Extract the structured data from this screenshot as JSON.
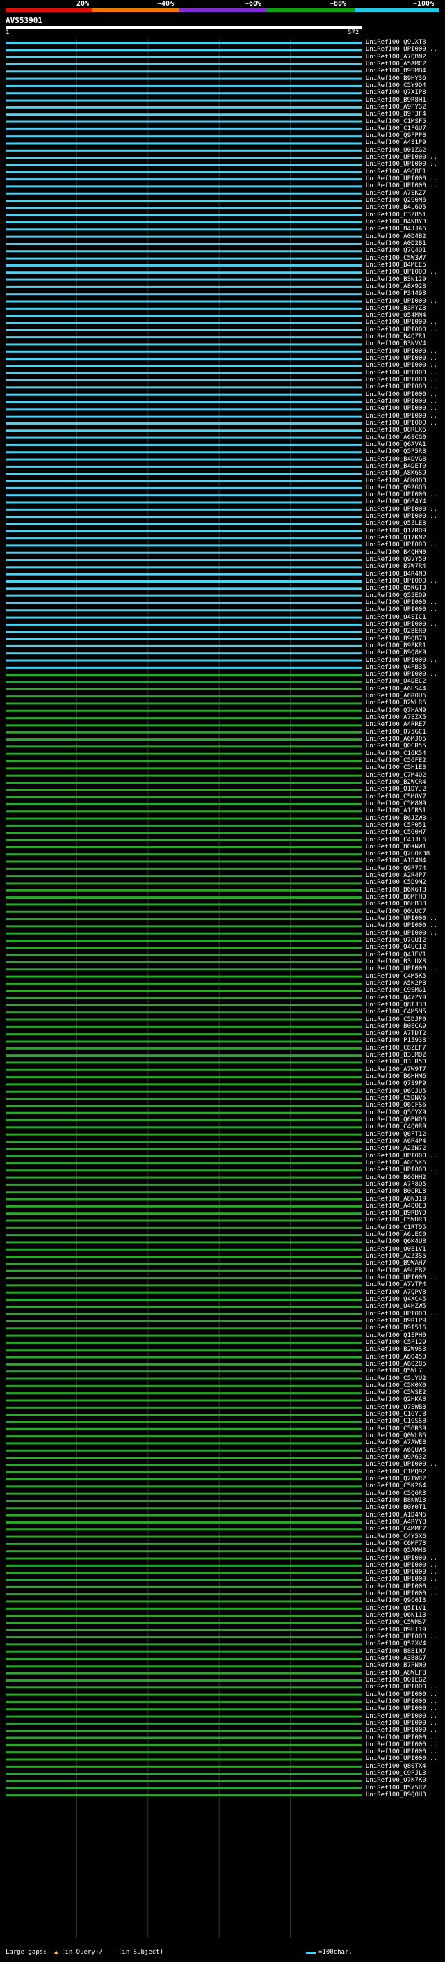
{
  "scale": {
    "labels": [
      "20%",
      "~40%",
      "~60%",
      "~80%",
      "~100%"
    ],
    "colors": [
      "#e01010",
      "#f07800",
      "#8030d0",
      "#10a010",
      "#20c8e0"
    ]
  },
  "query": {
    "title": "AVS53901",
    "start": "1",
    "end": "572"
  },
  "legend": {
    "gaps_label": "Large gaps:",
    "gap_query_text": "(in Query)/",
    "gap_subject_text": "(in Subject)",
    "scale_text": "=100char."
  },
  "colors": {
    "high_identity": "#4fd0f0",
    "medium_identity": "#2aa82a",
    "gap": "#000000",
    "label": "#ffffff"
  },
  "hits": [
    "UniRef100_Q9LXT8",
    "UniRef100_UPI000...",
    "UniRef100_A7QBN2",
    "UniRef100_A5AMC2",
    "UniRef100_B9SMB4",
    "UniRef100_B9HY36",
    "UniRef100_C5Y9D4",
    "UniRef100_Q7XIP8",
    "UniRef100_B9R8H1",
    "UniRef100_A9PYS2",
    "UniRef100_B9F3F4",
    "UniRef100_C1MSF5",
    "UniRef100_C1FGU7",
    "UniRef100_Q9FPP8",
    "UniRef100_A4S1P9",
    "UniRef100_Q01ZG2",
    "UniRef100_UPI000...",
    "UniRef100_UPI000...",
    "UniRef100_A9QBE1",
    "UniRef100_UPI000...",
    "UniRef100_UPI000...",
    "UniRef100_A7SKZ7",
    "UniRef100_Q2G0N6",
    "UniRef100_B4L6Q5",
    "UniRef100_C3Z851",
    "UniRef100_B4NBY3",
    "UniRef100_B4JJA6",
    "UniRef100_A0D4B2",
    "UniRef100_A0D2B1",
    "UniRef100_Q7Q4Q1",
    "UniRef100_C5W3W7",
    "UniRef100_B4MEE5",
    "UniRef100_UPI000...",
    "UniRef100_B3N129",
    "UniRef100_A8X928",
    "UniRef100_P34498",
    "UniRef100_UPI000...",
    "UniRef100_B3RYZ3",
    "UniRef100_Q54MN4",
    "UniRef100_UPI000...",
    "UniRef100_UPI000...",
    "UniRef100_B4QZR1",
    "UniRef100_B3NVV4",
    "UniRef100_UPI000...",
    "UniRef100_UPI000...",
    "UniRef100_UPI000...",
    "UniRef100_UPI000...",
    "UniRef100_UPI000...",
    "UniRef100_UPI000...",
    "UniRef100_UPI000...",
    "UniRef100_UPI000...",
    "UniRef100_UPI000...",
    "UniRef100_UPI000...",
    "UniRef100_UPI000...",
    "UniRef100_Q8RLX6",
    "UniRef100_A6SCG0",
    "UniRef100_Q6AVA1",
    "UniRef100_Q5P5R8",
    "UniRef100_B4DVG8",
    "UniRef100_B4DET0",
    "UniRef100_A8K6S9",
    "UniRef100_A8K0Q3",
    "UniRef100_Q92GQ5",
    "UniRef100_UPI000...",
    "UniRef100_Q6P4Y4",
    "UniRef100_UPI000...",
    "UniRef100_UPI000...",
    "UniRef100_Q5ZLE8",
    "UniRef100_Q17RO9",
    "UniRef100_Q17KN2",
    "UniRef100_UPI000...",
    "UniRef100_B4QHM0",
    "UniRef100_Q9VY50",
    "UniRef100_B7W7R4",
    "UniRef100_B4R4N0",
    "UniRef100_UPI000...",
    "UniRef100_Q5KGT3",
    "UniRef100_Q55EQ9",
    "UniRef100_UPI000...",
    "UniRef100_UPI000...",
    "UniRef100_Q4SIC1",
    "UniRef100_UPI000...",
    "UniRef100_Q2BER0",
    "UniRef100_B9QB70",
    "UniRef100_B9PKR1",
    "UniRef100_B9Q8K9",
    "UniRef100_UPI000...",
    "UniRef100_Q4PB35",
    "UniRef100_UPI000...",
    "UniRef100_Q4DEC2",
    "UniRef100_A6US44",
    "UniRef100_A6R0U6",
    "UniRef100_B2WLR6",
    "UniRef100_Q7HAM9",
    "UniRef100_A7EZX5",
    "UniRef100_A4RRE7",
    "UniRef100_Q75GC1",
    "UniRef100_A6MJ05",
    "UniRef100_Q0CR55",
    "UniRef100_C1GK54",
    "UniRef100_C5GFE2",
    "UniRef100_C5H1E3",
    "UniRef100_C7M4Q2",
    "UniRef100_B2WCR4",
    "UniRef100_Q1DYJ2",
    "UniRef100_C5M8Y7",
    "UniRef100_C5M8N9",
    "UniRef100_A1CRS1",
    "UniRef100_B6JZW3",
    "UniRef100_C5P051",
    "UniRef100_C5G0H7",
    "UniRef100_C4JJL6",
    "UniRef100_B0XNW1",
    "UniRef100_Q2U0K38",
    "UniRef100_A1D4N4",
    "UniRef100_Q9P774",
    "UniRef100_A2R4P7",
    "UniRef100_C5D9M2",
    "UniRef100_B6K6T8",
    "UniRef100_B8MFH0",
    "UniRef100_B6HB38",
    "UniRef100_Q0UUC7",
    "UniRef100_UPI000...",
    "UniRef100_UPI000...",
    "UniRef100_UPI000...",
    "UniRef100_Q7QUI2",
    "UniRef100_Q4UCI2",
    "UniRef100_Q4JEV1",
    "UniRef100_B3LUX8",
    "UniRef100_UPI000...",
    "UniRef100_C4M5K5",
    "UniRef100_A5K2P8",
    "UniRef100_C9SMG1",
    "UniRef100_Q4YZY9",
    "UniRef100_Q8TJ38",
    "UniRef100_C4M5M5",
    "UniRef100_C5DJP0",
    "UniRef100_B0ECA9",
    "UniRef100_A7TDT2",
    "UniRef100_P15938",
    "UniRef100_C8ZEF7",
    "UniRef100_B3LMQ2",
    "UniRef100_B3LR50",
    "UniRef100_A7W9T7",
    "UniRef100_B6HHM6",
    "UniRef100_Q7S9P9",
    "UniRef100_Q6CJU5",
    "UniRef100_C5DNV5",
    "UniRef100_Q6CFS6",
    "UniRef100_Q5CYX9",
    "UniRef100_Q6BNQ6",
    "UniRef100_C4Q0R9",
    "UniRef100_Q6FT12",
    "UniRef100_A6R4P4",
    "UniRef100_A2ZN72",
    "UniRef100_UPI000...",
    "UniRef100_A0C5K6",
    "UniRef100_UPI000...",
    "UniRef100_B6GHH2",
    "UniRef100_A7F8Q5",
    "UniRef100_B0CRL8",
    "UniRef100_A8N319",
    "UniRef100_A4QQE3",
    "UniRef100_B9RBY0",
    "UniRef100_C5WUR3",
    "UniRef100_C1RTQ5",
    "UniRef100_A6LEC0",
    "UniRef100_Q6K4U8",
    "UniRef100_Q0E1V1",
    "UniRef100_A2Z3S5",
    "UniRef100_B9WAH7",
    "UniRef100_A9UEB2",
    "UniRef100_UPI000...",
    "UniRef100_A7VTP4",
    "UniRef100_A7QPV8",
    "UniRef100_Q4XC45",
    "UniRef100_Q4HZW5",
    "UniRef100_UPI000...",
    "UniRef100_B9R1P9",
    "UniRef100_B9I516",
    "UniRef100_Q1EPH0",
    "UniRef100_C5P129",
    "UniRef100_B2W9S3",
    "UniRef100_A8Q450",
    "UniRef100_A6Q285",
    "UniRef100_Q5WL7",
    "UniRef100_C5LYU2",
    "UniRef100_C5K0X0",
    "UniRef100_C5WSE2",
    "UniRef100_Q2HKA8",
    "UniRef100_Q7SWB3",
    "UniRef100_C1GYJ8",
    "UniRef100_C1GSS8",
    "UniRef100_C5GR39",
    "UniRef100_Q0WLB6",
    "UniRef100_A7AWE8",
    "UniRef100_A6QUW5",
    "UniRef100_Q9A632",
    "UniRef100_UPI000...",
    "UniRef100_C1MQ92",
    "UniRef100_Q2TWR2",
    "UniRef100_C5K264",
    "UniRef100_C5Q6R3",
    "UniRef100_B8NW13",
    "UniRef100_B0Y0T1",
    "UniRef100_A1D4M6",
    "UniRef100_A4RYY8",
    "UniRef100_C4MME7",
    "UniRef100_C4Y5X6",
    "UniRef100_C6MF73",
    "UniRef100_Q5AMH3",
    "UniRef100_UPI000...",
    "UniRef100_UPI000...",
    "UniRef100_UPI000...",
    "UniRef100_UPI000...",
    "UniRef100_UPI000...",
    "UniRef100_UPI000...",
    "UniRef100_Q9C0I3",
    "UniRef100_Q5I1V1",
    "UniRef100_Q6N113",
    "UniRef100_C5WMS7",
    "UniRef100_B9HI19",
    "UniRef100_UPI000...",
    "UniRef100_Q52XV4",
    "UniRef100_B8B1N7",
    "UniRef100_A3B8G7",
    "UniRef100_B7PNN0",
    "UniRef100_A8WLF8",
    "UniRef100_Q01EG2",
    "UniRef100_UPI000...",
    "UniRef100_UPI000...",
    "UniRef100_UPI000...",
    "UniRef100_UPI000...",
    "UniRef100_UPI000...",
    "UniRef100_UPI000...",
    "UniRef100_UPI000...",
    "UniRef100_UPI000...",
    "UniRef100_UPI000...",
    "UniRef100_UPI000...",
    "UniRef100_UPI000...",
    "UniRef100_Q80TX4",
    "UniRef100_C9PJL3",
    "UniRef100_Q7K7K0",
    "UniRef100_B5Y5R7",
    "UniRef100_B9Q0U3"
  ]
}
